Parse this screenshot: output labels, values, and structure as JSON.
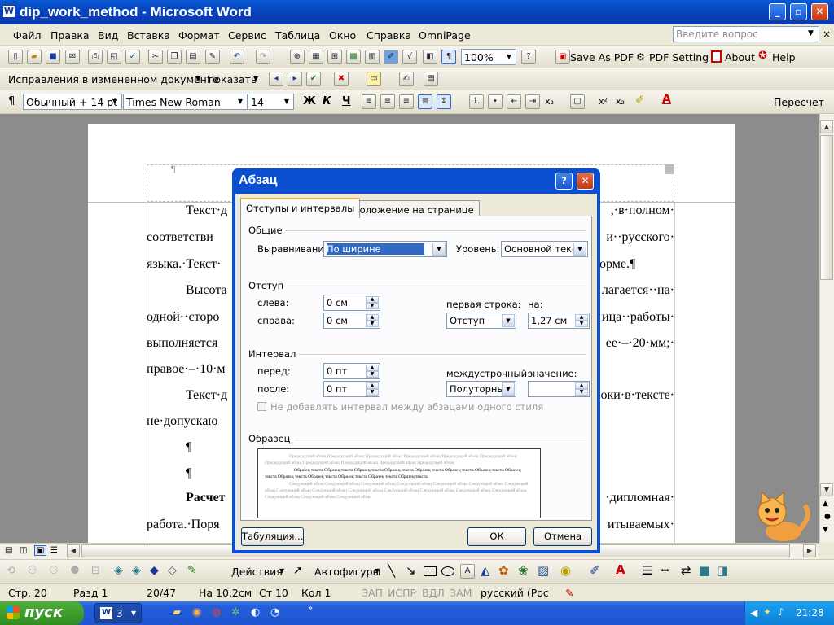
{
  "window": {
    "title": "dip_work_method - Microsoft Word",
    "controls": {
      "minimize": "_",
      "maximize": "▫",
      "close": "✕"
    }
  },
  "menu": {
    "items": [
      "Файл",
      "Правка",
      "Вид",
      "Вставка",
      "Формат",
      "Сервис",
      "Таблица",
      "Окно",
      "Справка",
      "OmniPage"
    ],
    "help_placeholder": "Введите вопрос"
  },
  "toolbar_standard": {
    "zoom": "100%",
    "save_as_pdf": "Save As PDF",
    "pdf_setting": "PDF Setting",
    "about": "About",
    "help": "Help"
  },
  "toolbar_review": {
    "display": "Исправления в измененном документе",
    "show": "Показать"
  },
  "toolbar_format": {
    "style": "Обычный + 14 pt",
    "font": "Times New Roman",
    "size": "14",
    "bold": "Ж",
    "italic": "К",
    "underline": "Ч",
    "recalc": "Пересчет"
  },
  "document": {
    "pilcrow_header": "¶",
    "lines": [
      "Текст·д",
      "соответстви",
      "языка.·Текст·",
      "Высота",
      "одной··сторо",
      "выполняется",
      "правое·–·10·м",
      "Текст·д",
      "не·допускаю",
      "¶",
      "¶",
      "Расчет",
      "работа.·Поря"
    ],
    "right_lines": [
      ",·в·полном·",
      "и··русского·",
      "орме.¶",
      "лагается··на·",
      "ица··работы·",
      "ее·–·20·мм;·",
      "",
      "оки·в·тексте·",
      "",
      "",
      "",
      "·дипломная·",
      "итываемых·"
    ]
  },
  "dialog": {
    "title": "Абзац",
    "help_btn": "?",
    "close_btn": "✕",
    "tabs": [
      "Отступы и интервалы",
      "Положение на странице"
    ],
    "general_group": "Общие",
    "alignment_label": "Выравнивание:",
    "alignment_value": "По ширине",
    "level_label": "Уровень:",
    "level_value": "Основной текст",
    "indent_group": "Отступ",
    "left_label": "слева:",
    "left_value": "0 см",
    "right_label": "справа:",
    "right_value": "0 см",
    "first_line_label": "первая строка:",
    "first_line_value": "Отступ",
    "on_label": "на:",
    "on_value": "1,27 см",
    "spacing_group": "Интервал",
    "before_label": "перед:",
    "before_value": "0 пт",
    "after_label": "после:",
    "after_value": "0 пт",
    "line_spacing_label": "междустрочный:",
    "line_spacing_value": "Полуторный",
    "value_label": "значение:",
    "value_value": "",
    "no_space_checkbox": "Не добавлять интервал между абзацами одного стиля",
    "preview_group": "Образец",
    "preview_prev": "Предыдущий абзац Предыдущий абзац Предыдущий абзац Предыдущий абзац Предыдущий абзац Предыдущий абзац Предыдущий абзац Предыдущий абзац Предыдущий абзац Предыдущий абзац Предыдущий абзац",
    "preview_sample": "Образец текста Образец текста Образец текста Образец текста Образец текста Образец текста Образец текста Образец текста Образец текста Образец текста Образец текста Образец текста Образец текста",
    "preview_next": "Следующий абзац Следующий абзац Следующий абзац Следующий абзац Следующий абзац Следующий абзац Следующий абзац Следующий абзац Следующий абзац Следующий абзац Следующий абзац Следующий абзац Следующий абзац Следующий абзац Следующий абзац Следующий абзац Следующий абзац",
    "tabs_button": "Табуляция...",
    "ok_button": "ОК",
    "cancel_button": "Отмена"
  },
  "drawing_toolbar": {
    "actions": "Действия",
    "autoshapes": "Автофигуры"
  },
  "status": {
    "page": "Стр. 20",
    "section": "Разд 1",
    "pages": "20/47",
    "at": "На 10,2см",
    "line": "Ст 10",
    "col": "Кол 1",
    "rec": "ЗАП",
    "trk": "ИСПР",
    "ext": "ВДЛ",
    "ovr": "ЗАМ",
    "lang": "русский (Рос"
  },
  "taskbar": {
    "start": "пуск",
    "word_group": "3",
    "clock": "21:28"
  }
}
